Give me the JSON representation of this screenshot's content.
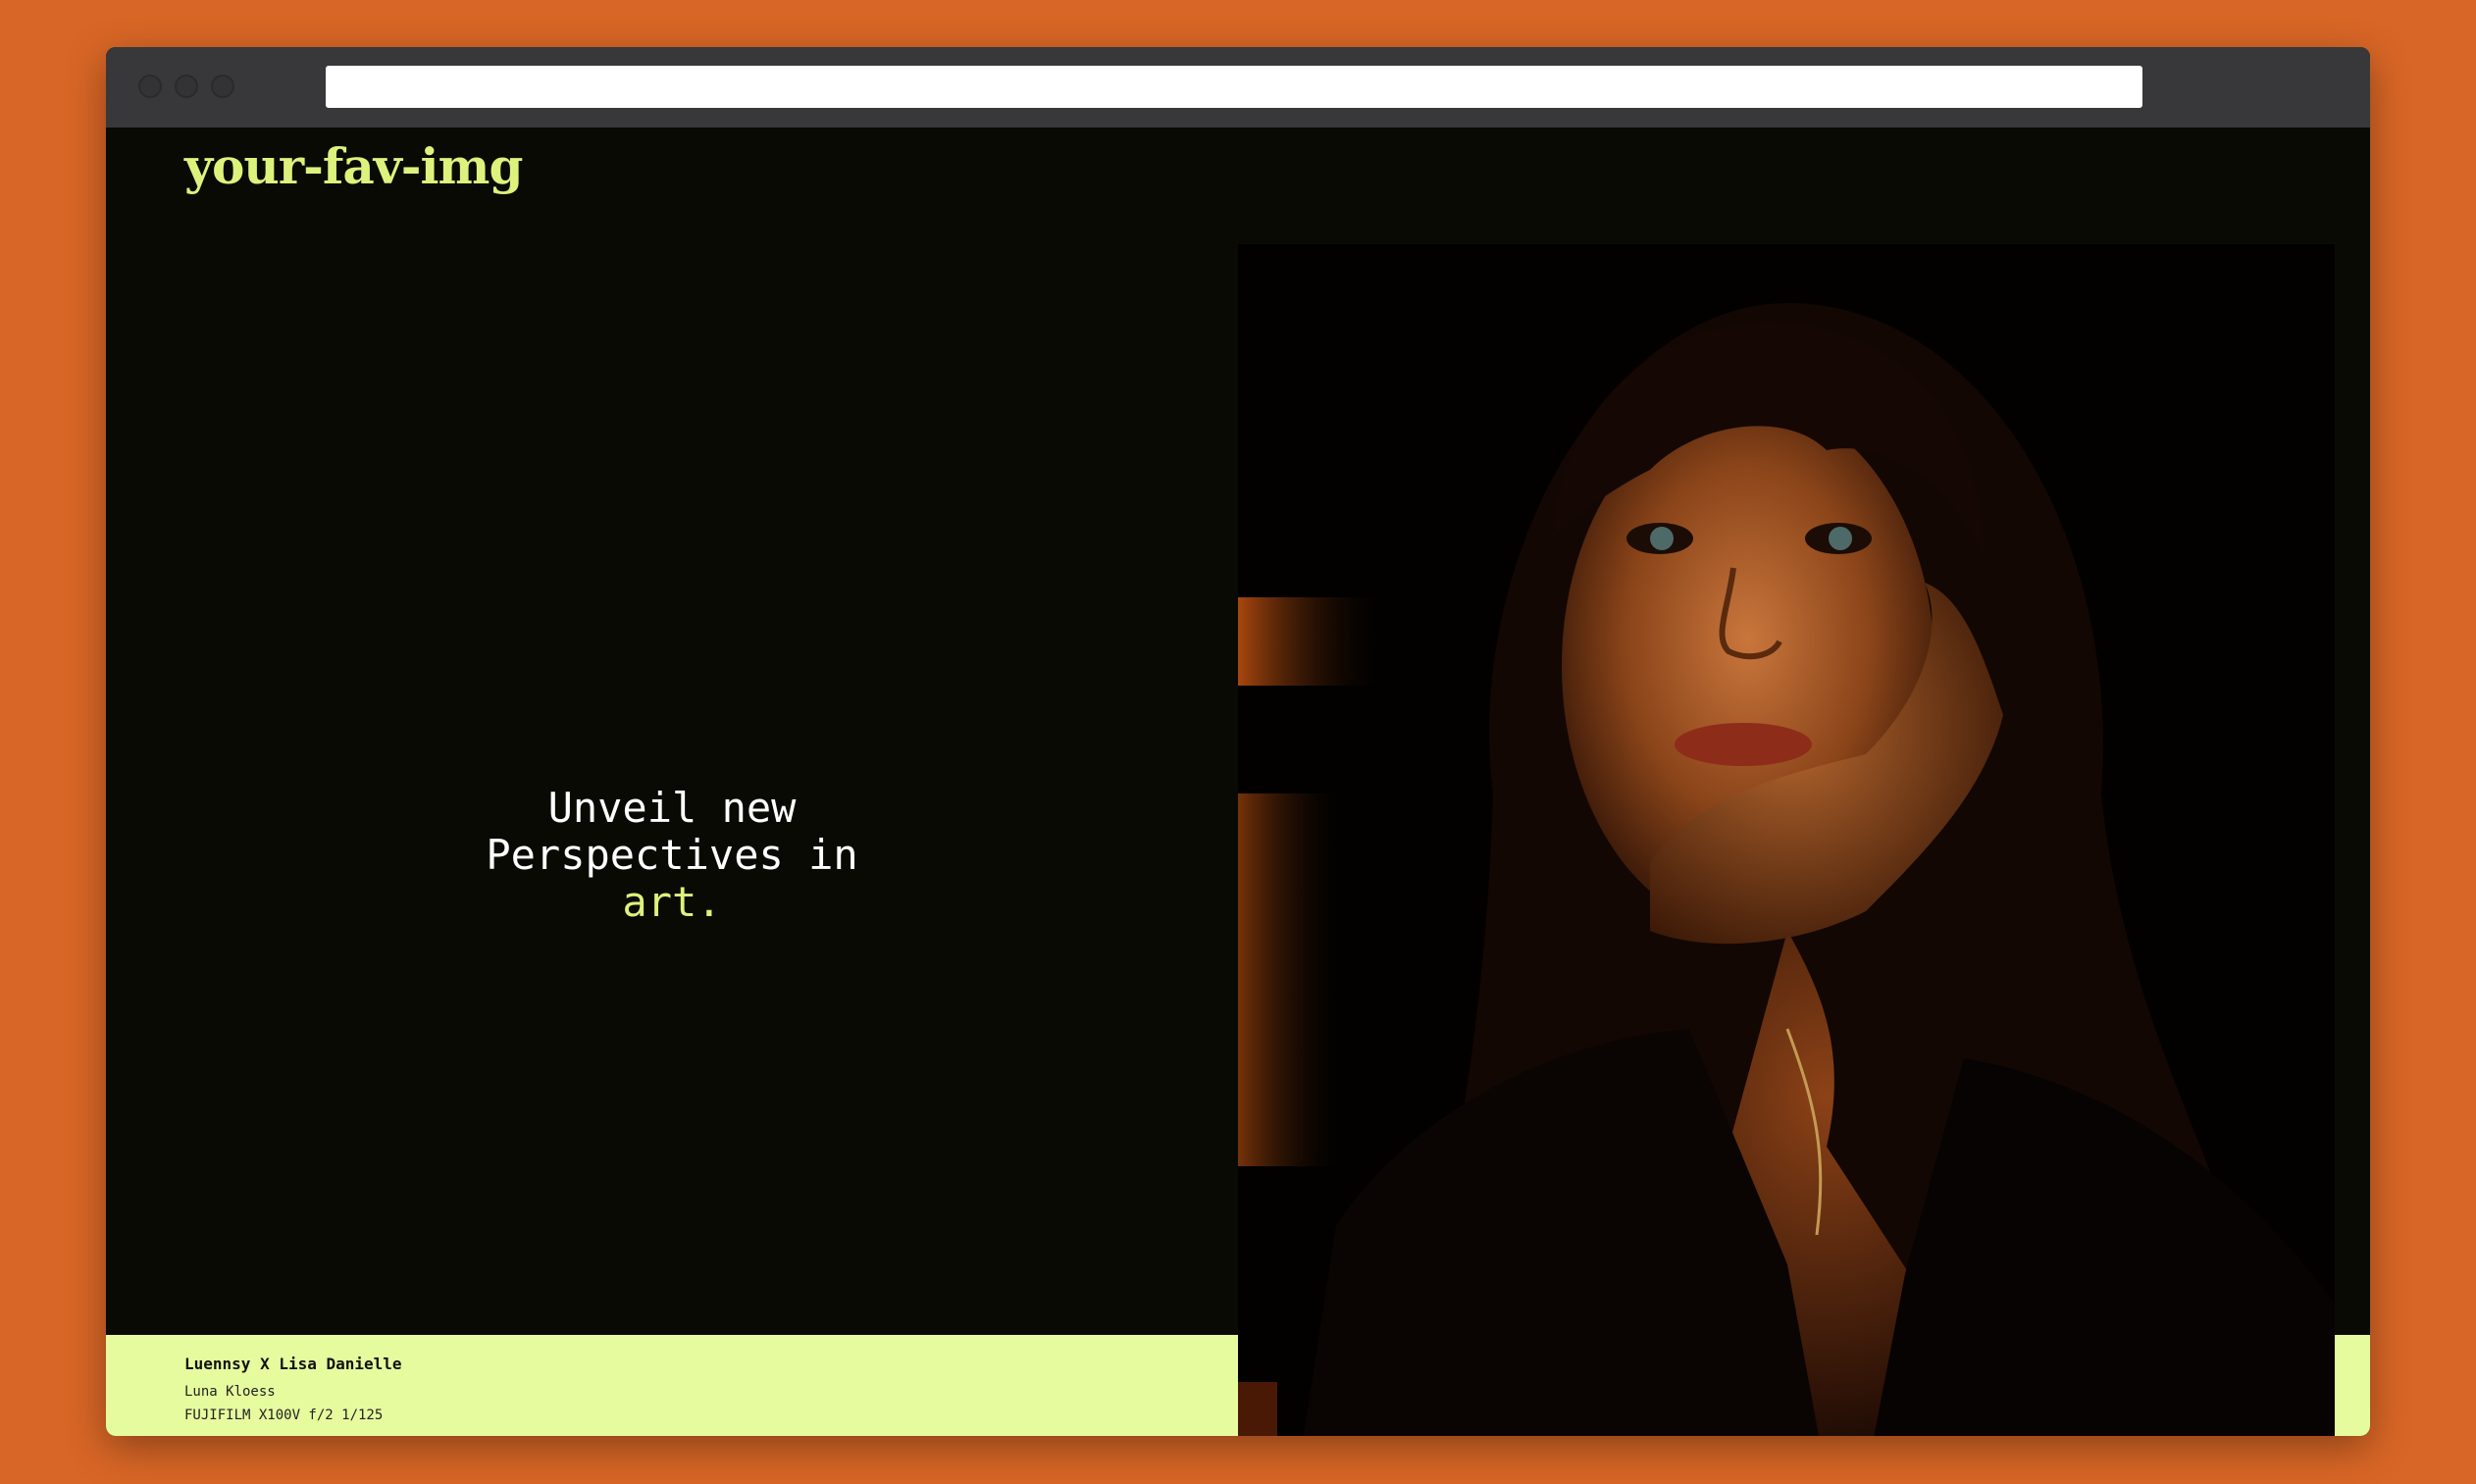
{
  "site": {
    "logo": "your-fav-img"
  },
  "hero": {
    "line1": "Unveil new",
    "line2": "Perspectives in",
    "accent": "art.",
    "accent_color": "#ddf27c"
  },
  "caption": {
    "title": "Luennsy X Lisa Danielle",
    "author": "Luna Kloess",
    "camera": "FUJIFILM X100V f/2 1/125"
  },
  "colors": {
    "backdrop": "#d86626",
    "page_bg": "#0a0a05",
    "caption_bg": "#e6fb9e"
  }
}
